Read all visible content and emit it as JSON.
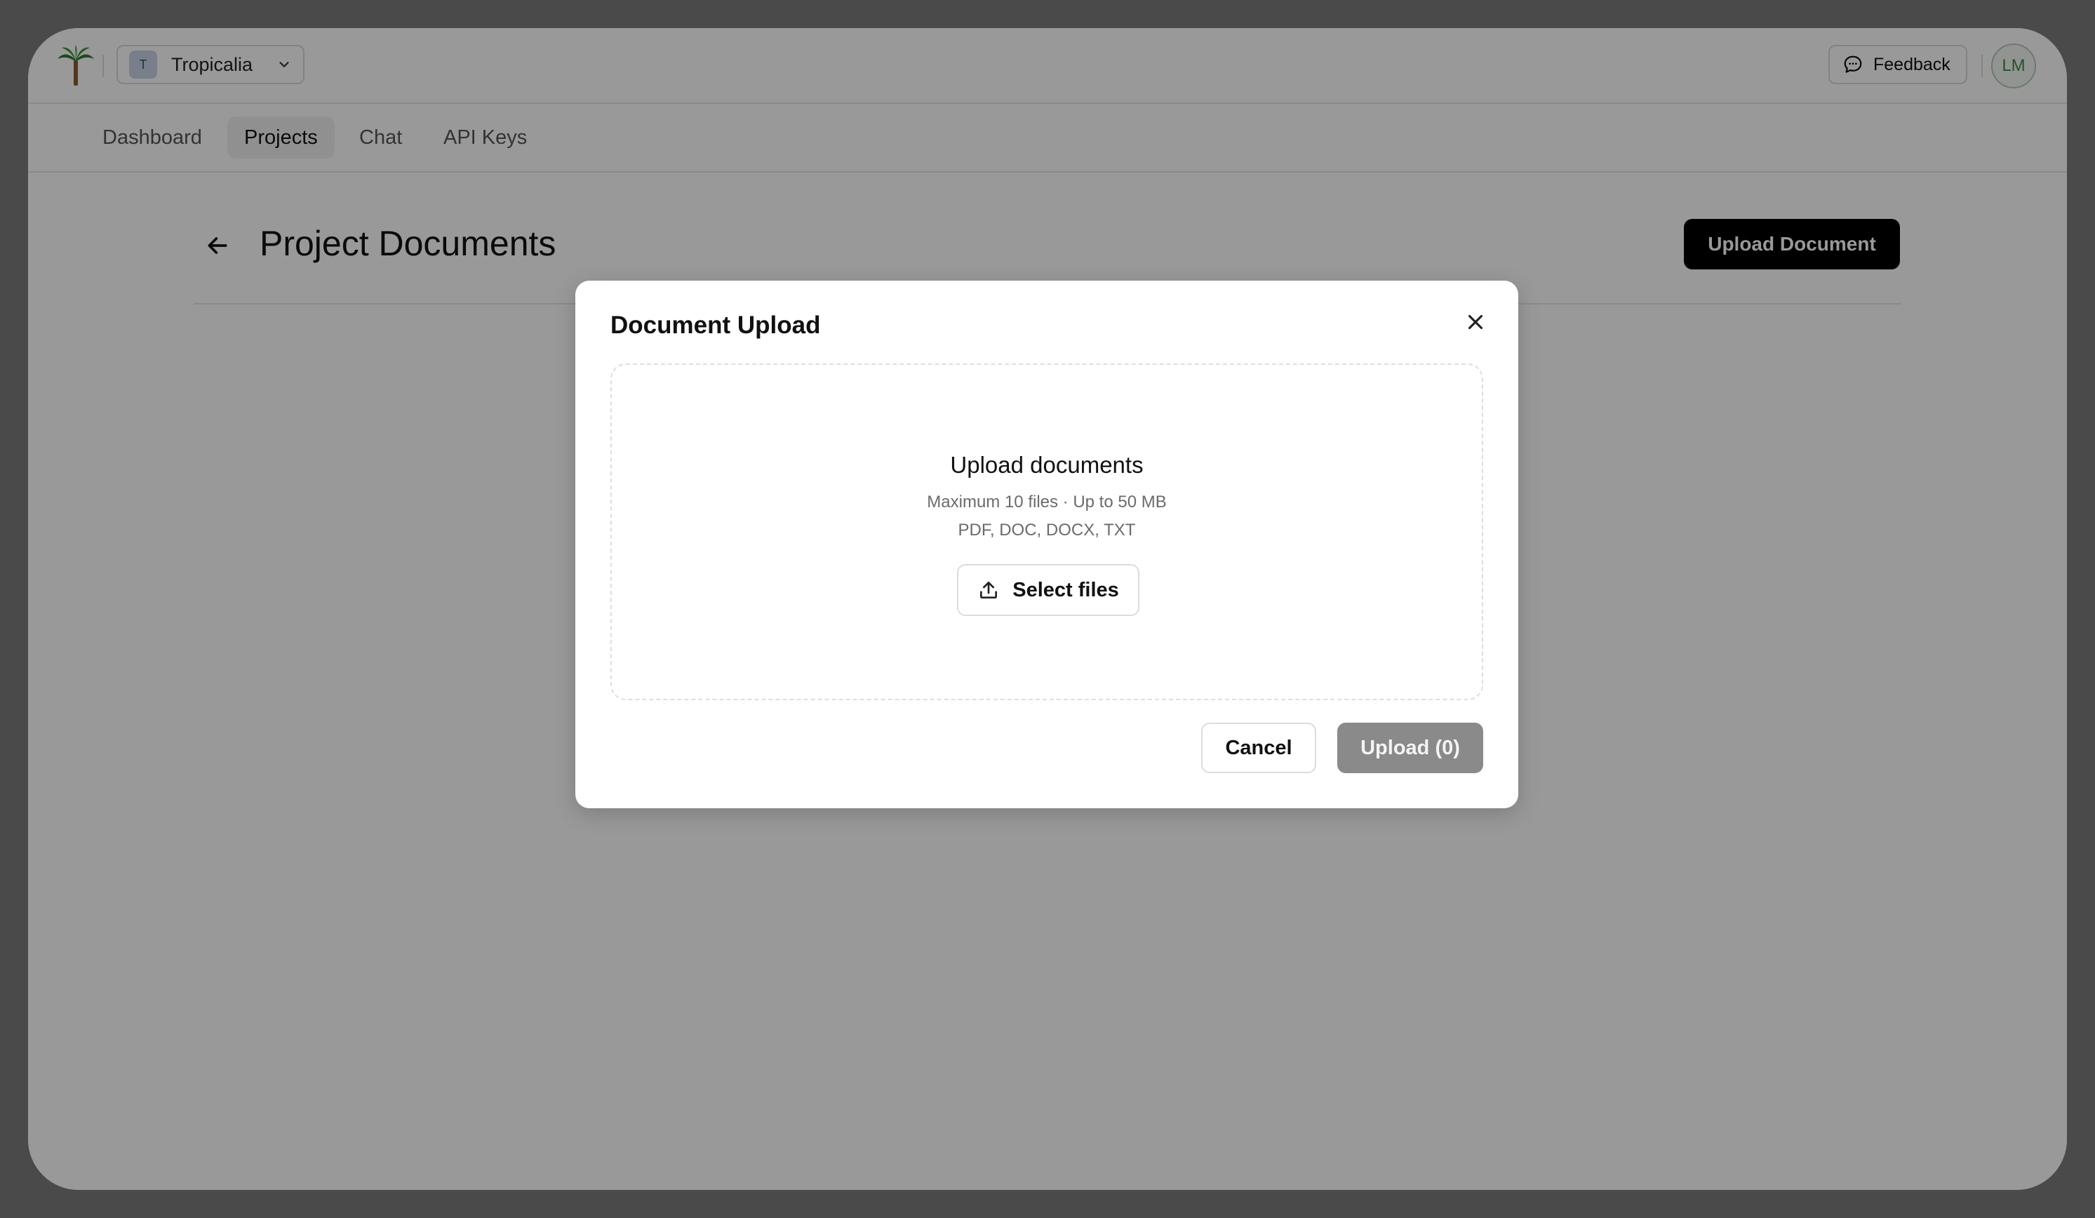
{
  "topbar": {
    "workspace": {
      "badge": "T",
      "name": "Tropicalia"
    },
    "feedback_label": "Feedback",
    "avatar_initials": "LM"
  },
  "nav": {
    "tabs": [
      {
        "label": "Dashboard",
        "active": false
      },
      {
        "label": "Projects",
        "active": true
      },
      {
        "label": "Chat",
        "active": false
      },
      {
        "label": "API Keys",
        "active": false
      }
    ]
  },
  "page": {
    "title": "Project Documents",
    "upload_button_label": "Upload Document"
  },
  "modal": {
    "title": "Document Upload",
    "dropzone": {
      "title": "Upload documents",
      "limits": "Maximum 10 files · Up to 50 MB",
      "types": "PDF, DOC, DOCX, TXT",
      "select_label": "Select files"
    },
    "cancel_label": "Cancel",
    "upload_label": "Upload (0)"
  },
  "colors": {
    "primary_button": "#000000",
    "disabled_button": "#8a8a8a",
    "overlay": "rgba(0,0,0,0.40)",
    "avatar_text": "#3b8a4a"
  }
}
